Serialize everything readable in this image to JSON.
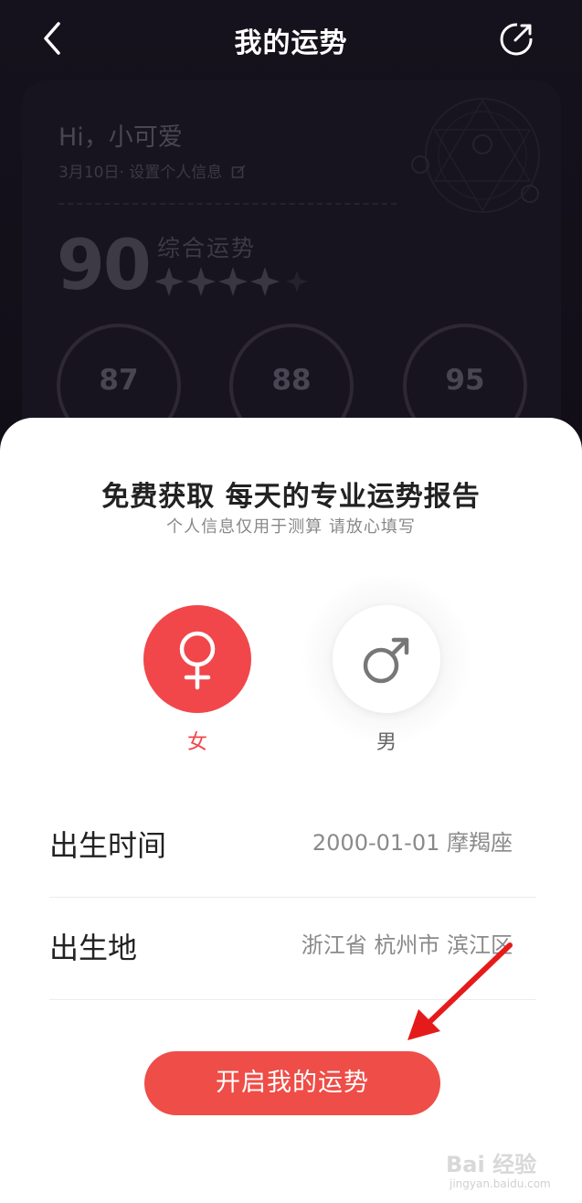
{
  "nav": {
    "title": "我的运势"
  },
  "profile": {
    "greeting": "Hi，小可爱",
    "subline": "3月10日· 设置个人信息"
  },
  "overall": {
    "score": "90",
    "label": "综合运势",
    "stars_filled": 4,
    "stars_total": 5
  },
  "rings": [
    {
      "value": "87"
    },
    {
      "value": "88"
    },
    {
      "value": "95"
    }
  ],
  "sheet": {
    "title": "免费获取 每天的专业运势报告",
    "subtitle": "个人信息仅用于测算 请放心填写",
    "gender": {
      "female_label": "女",
      "male_label": "男",
      "selected": "female"
    },
    "birth_time": {
      "label": "出生时间",
      "value": "2000-01-01 摩羯座"
    },
    "birth_place": {
      "label": "出生地",
      "value": "浙江省 杭州市 滨江区"
    },
    "cta_label": "开启我的运势"
  },
  "colors": {
    "accent": "#ef4d47",
    "female_accent": "#f1474a"
  },
  "watermark": {
    "text": "Bai 经验",
    "url": "jingyan.baidu.com"
  }
}
